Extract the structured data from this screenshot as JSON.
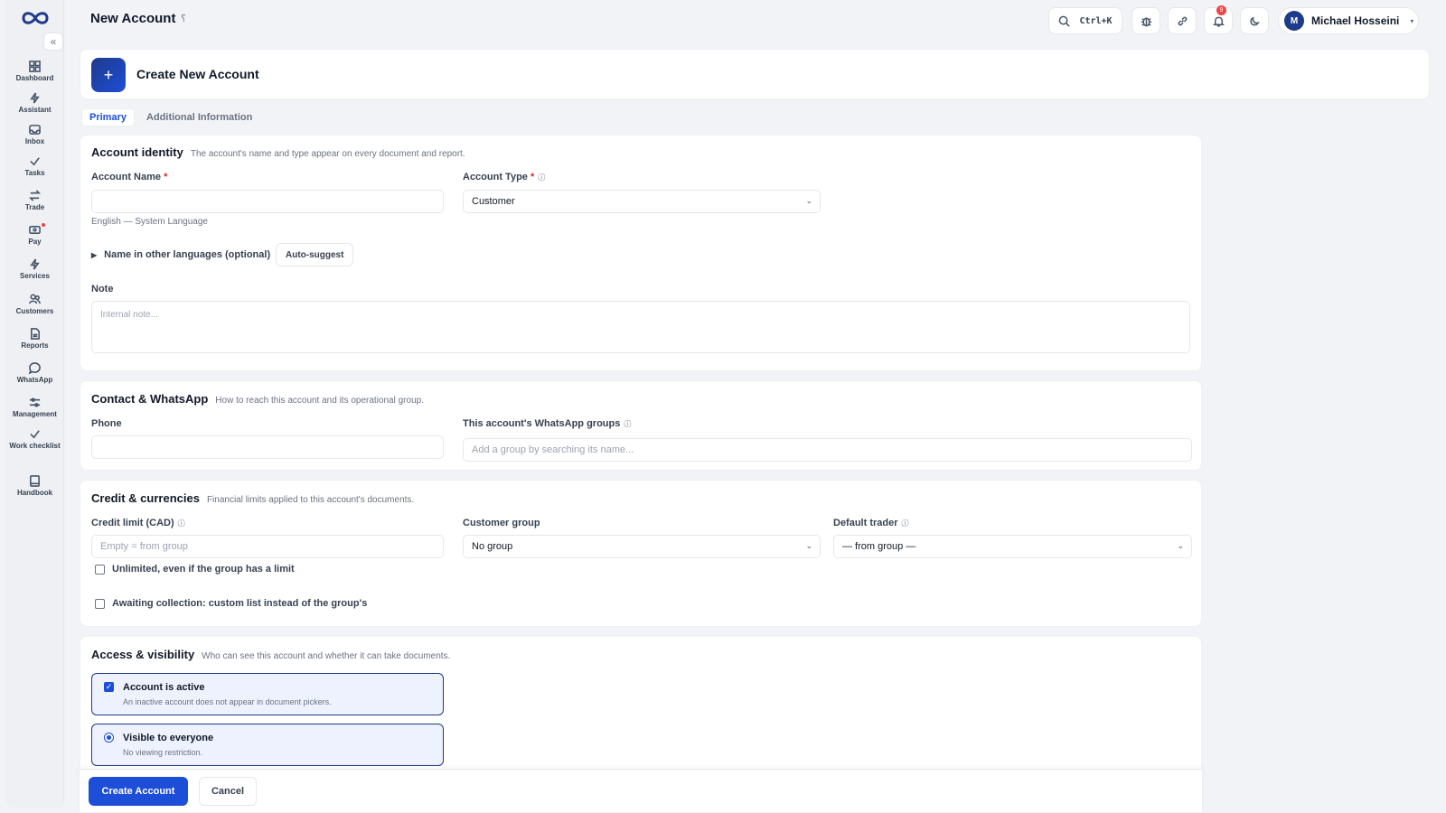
{
  "app": {
    "page_title": "New Account",
    "title_pin_icon": "pin-icon"
  },
  "sidebar": {
    "collapse_label": "«",
    "items": [
      {
        "label": "Dashboard",
        "icon": "dashboard-icon"
      },
      {
        "label": "Assistant",
        "icon": "bolt-icon"
      },
      {
        "label": "Inbox",
        "icon": "inbox-icon"
      },
      {
        "label": "Tasks",
        "icon": "check-icon"
      },
      {
        "label": "Trade",
        "icon": "swap-icon"
      },
      {
        "label": "Pay",
        "icon": "wallet-icon"
      },
      {
        "label": "Services",
        "icon": "bolt-icon"
      },
      {
        "label": "Customers",
        "icon": "users-icon"
      },
      {
        "label": "Reports",
        "icon": "report-icon"
      },
      {
        "label": "WhatsApp",
        "icon": "chat-icon"
      },
      {
        "label": "Management",
        "icon": "sliders-icon"
      },
      {
        "label": "Work checklist",
        "icon": "check-icon"
      },
      {
        "label": "Handbook",
        "icon": "book-icon"
      }
    ]
  },
  "topbar": {
    "search_shortcut": "Ctrl+K",
    "notifications_count": "9",
    "user": {
      "initial": "M",
      "name": "Michael Hosseini",
      "caret": "▾"
    }
  },
  "header": {
    "plus": "+",
    "title": "Create New Account"
  },
  "tabs": [
    {
      "label": "Primary",
      "active": true
    },
    {
      "label": "Additional Information",
      "active": false
    }
  ],
  "identity": {
    "title": "Account identity",
    "desc": "The account's name and type appear on every document and report.",
    "account_name_label": "Account Name",
    "required_mark": "*",
    "account_name_value": "",
    "account_name_hint": "English — System Language",
    "account_type_label": "Account Type",
    "account_type_value": "Customer",
    "other_languages_label": "Name in other languages (optional)",
    "auto_suggest_label": "Auto-suggest",
    "note_label": "Note",
    "note_placeholder": "Internal note..."
  },
  "contact": {
    "title": "Contact & WhatsApp",
    "desc": "How to reach this account and its operational group.",
    "phone_label": "Phone",
    "phone_value": "",
    "groups_label": "This account's WhatsApp groups",
    "groups_placeholder": "Add a group by searching its name..."
  },
  "credit": {
    "title": "Credit & currencies",
    "desc": "Financial limits applied to this account's documents.",
    "credit_limit_label": "Credit limit (CAD)",
    "credit_limit_placeholder": "Empty = from group",
    "customer_group_label": "Customer group",
    "customer_group_value": "No group",
    "default_trader_label": "Default trader",
    "default_trader_value": "— from group —",
    "unlimited_label": "Unlimited, even if the group has a limit",
    "unlimited_checked": false,
    "awaiting_label": "Awaiting collection: custom list instead of the group's",
    "awaiting_checked": false
  },
  "access": {
    "title": "Access & visibility",
    "desc": "Who can see this account and whether it can take documents.",
    "active_title": "Account is active",
    "active_desc": "An inactive account does not appear in document pickers.",
    "active_checked": true,
    "visible_title": "Visible to everyone",
    "visible_desc": "No viewing restriction.",
    "visible_selected": true
  },
  "footer": {
    "create_label": "Create Account",
    "cancel_label": "Cancel"
  },
  "colors": {
    "primary": "#1d4ed8",
    "brand_dark": "#1e3a8a",
    "required": "#dc2626",
    "badge": "#ef4444"
  }
}
